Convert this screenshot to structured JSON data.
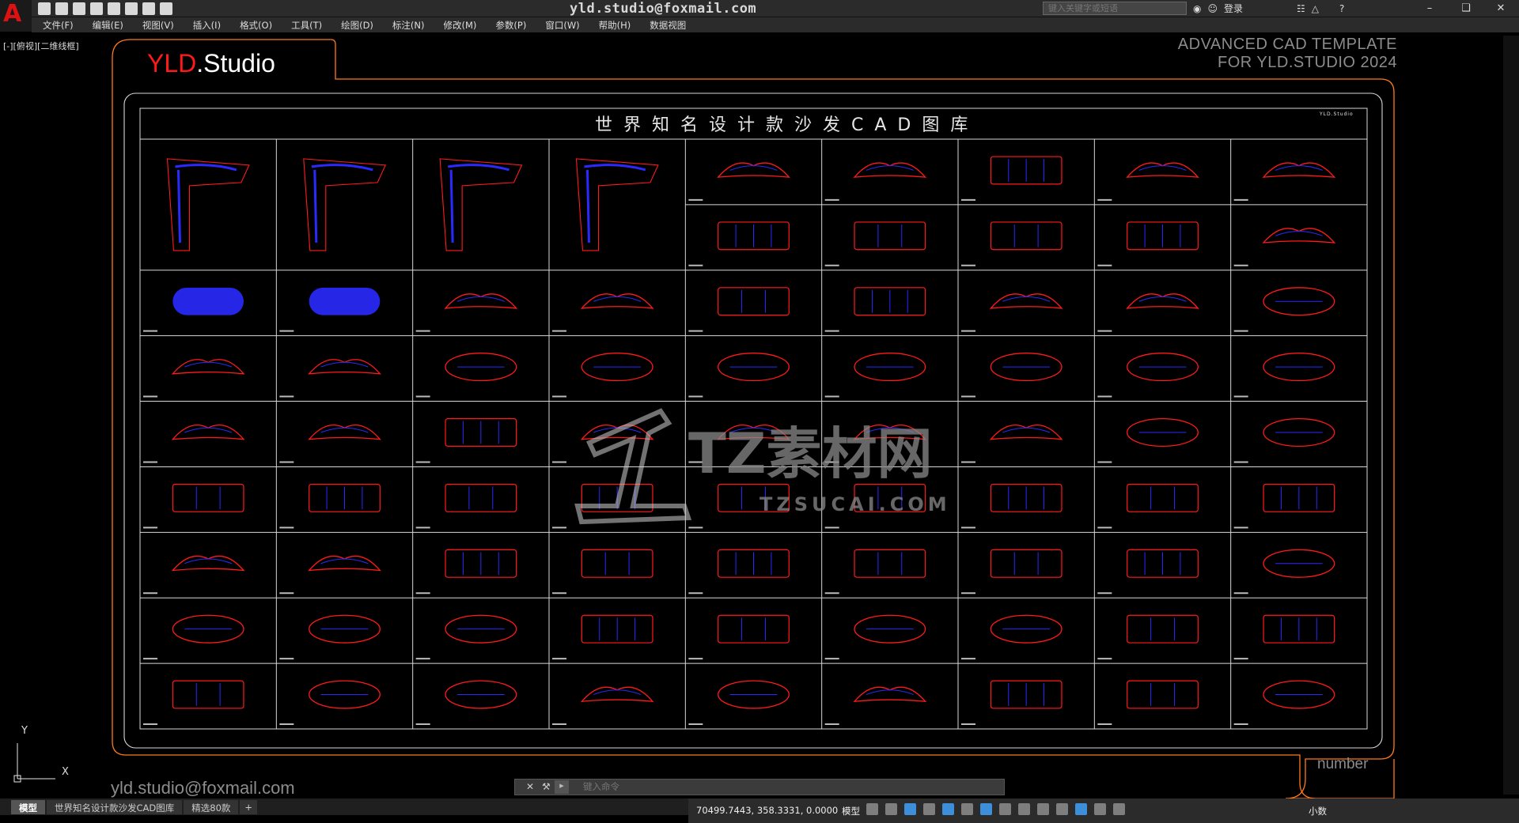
{
  "window": {
    "title": "yld.studio@foxmail.com",
    "search_placeholder": "键入关键字或短语",
    "login_label": "登录"
  },
  "menu": [
    "文件(F)",
    "编辑(E)",
    "视图(V)",
    "插入(I)",
    "格式(O)",
    "工具(T)",
    "绘图(D)",
    "标注(N)",
    "修改(M)",
    "参数(P)",
    "窗口(W)",
    "帮助(H)",
    "数据视图"
  ],
  "viewport_label": "[-][俯视][二维线框]",
  "brand": {
    "prefix": "YLD",
    "suffix": ".Studio"
  },
  "template_text": {
    "line1": "ADVANCED  CAD  TEMPLATE",
    "line2": "FOR YLD.STUDIO 2024"
  },
  "sheet": {
    "title": "世界知名设计款沙发CAD图库",
    "corner_label": "YLD.Studio"
  },
  "watermark": {
    "cn": "TZ素材网",
    "en": "TZSUCAI.COM"
  },
  "footer": {
    "email": "yld.studio@foxmail.com",
    "number_label": "number"
  },
  "ucs": {
    "y": "Y",
    "x": "X"
  },
  "command": {
    "placeholder": "键入命令"
  },
  "layout_tabs": [
    "模型",
    "世界知名设计款沙发CAD图库",
    "精选80款"
  ],
  "status": {
    "coords": "70499.7443, 358.3331, 0.0000",
    "model": "模型",
    "units": "小数"
  },
  "colors": {
    "frame": "#ff7a1a",
    "sofa": "#ff1a1a",
    "detail": "#2a2aff",
    "sheet_line": "#d8d8d8"
  }
}
